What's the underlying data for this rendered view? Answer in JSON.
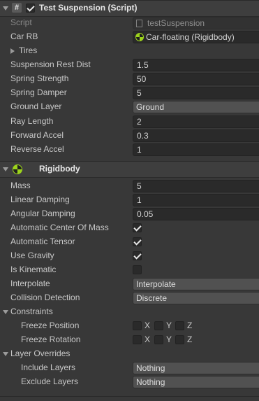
{
  "script_component": {
    "title": "Test Suspension (Script)",
    "enabled": true,
    "script_label": "Script",
    "script_value": "testSuspension",
    "car_rb_label": "Car RB",
    "car_rb_value": "Car-floating (Rigidbody)",
    "tires_label": "Tires",
    "fields": [
      {
        "label": "Suspension Rest Dist",
        "value": "1.5"
      },
      {
        "label": "Spring Strength",
        "value": "50"
      },
      {
        "label": "Spring Damper",
        "value": "5"
      },
      {
        "label": "Ground Layer",
        "value": "Ground"
      },
      {
        "label": "Ray Length",
        "value": "2"
      },
      {
        "label": "Forward Accel",
        "value": "0.3"
      },
      {
        "label": "Reverse Accel",
        "value": "1"
      }
    ]
  },
  "rigidbody": {
    "title": "Rigidbody",
    "mass_label": "Mass",
    "mass_value": "5",
    "linear_damping_label": "Linear Damping",
    "linear_damping_value": "1",
    "angular_damping_label": "Angular Damping",
    "angular_damping_value": "0.05",
    "auto_com_label": "Automatic Center Of Mass",
    "auto_com_checked": true,
    "auto_tensor_label": "Automatic Tensor",
    "auto_tensor_checked": true,
    "use_gravity_label": "Use Gravity",
    "use_gravity_checked": true,
    "is_kinematic_label": "Is Kinematic",
    "is_kinematic_checked": false,
    "interpolate_label": "Interpolate",
    "interpolate_value": "Interpolate",
    "collision_label": "Collision Detection",
    "collision_value": "Discrete",
    "constraints_label": "Constraints",
    "freeze_position_label": "Freeze Position",
    "freeze_rotation_label": "Freeze Rotation",
    "axes": [
      "X",
      "Y",
      "Z"
    ],
    "layer_overrides_label": "Layer Overrides",
    "include_layers_label": "Include Layers",
    "include_layers_value": "Nothing",
    "exclude_layers_label": "Exclude Layers",
    "exclude_layers_value": "Nothing"
  }
}
